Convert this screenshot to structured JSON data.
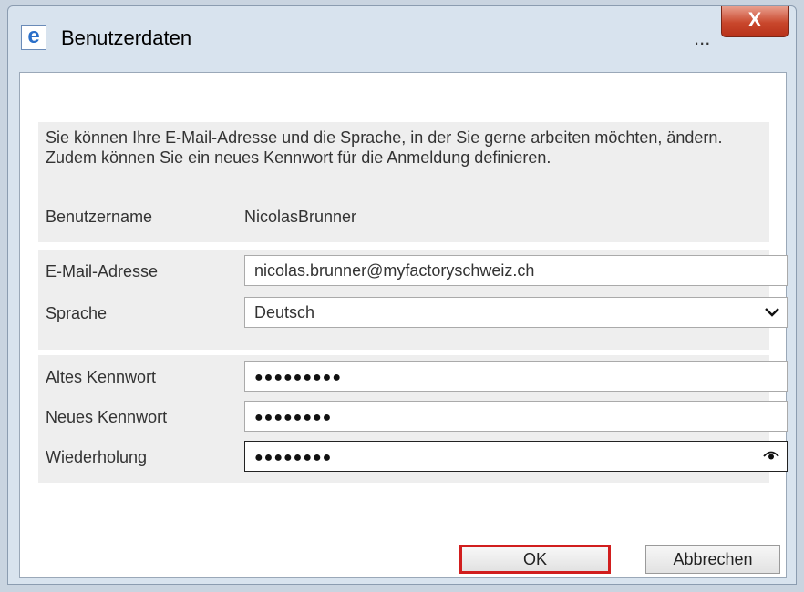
{
  "window": {
    "title": "Benutzerdaten",
    "overflow_label": "...",
    "close_label": "X"
  },
  "intro_text": "Sie können Ihre E-Mail-Adresse und die Sprache, in der Sie gerne arbeiten möchten, ändern. Zudem können Sie ein neues Kennwort für die Anmeldung definieren.",
  "username": {
    "label": "Benutzername",
    "value": "NicolasBrunner"
  },
  "email": {
    "label": "E-Mail-Adresse",
    "value": "nicolas.brunner@myfactoryschweiz.ch"
  },
  "language": {
    "label": "Sprache",
    "value": "Deutsch"
  },
  "old_password": {
    "label": "Altes Kennwort",
    "value": "●●●●●●●●●"
  },
  "new_password": {
    "label": "Neues Kennwort",
    "value": "●●●●●●●●"
  },
  "repeat_password": {
    "label": "Wiederholung",
    "value": "●●●●●●●●"
  },
  "buttons": {
    "ok": "OK",
    "cancel": "Abbrechen"
  },
  "colors": {
    "highlight": "#d11e1e",
    "close_button": "#c9472c"
  },
  "icons": [
    "ie-app-icon",
    "close-icon",
    "chevron-down-icon",
    "eye-icon"
  ]
}
